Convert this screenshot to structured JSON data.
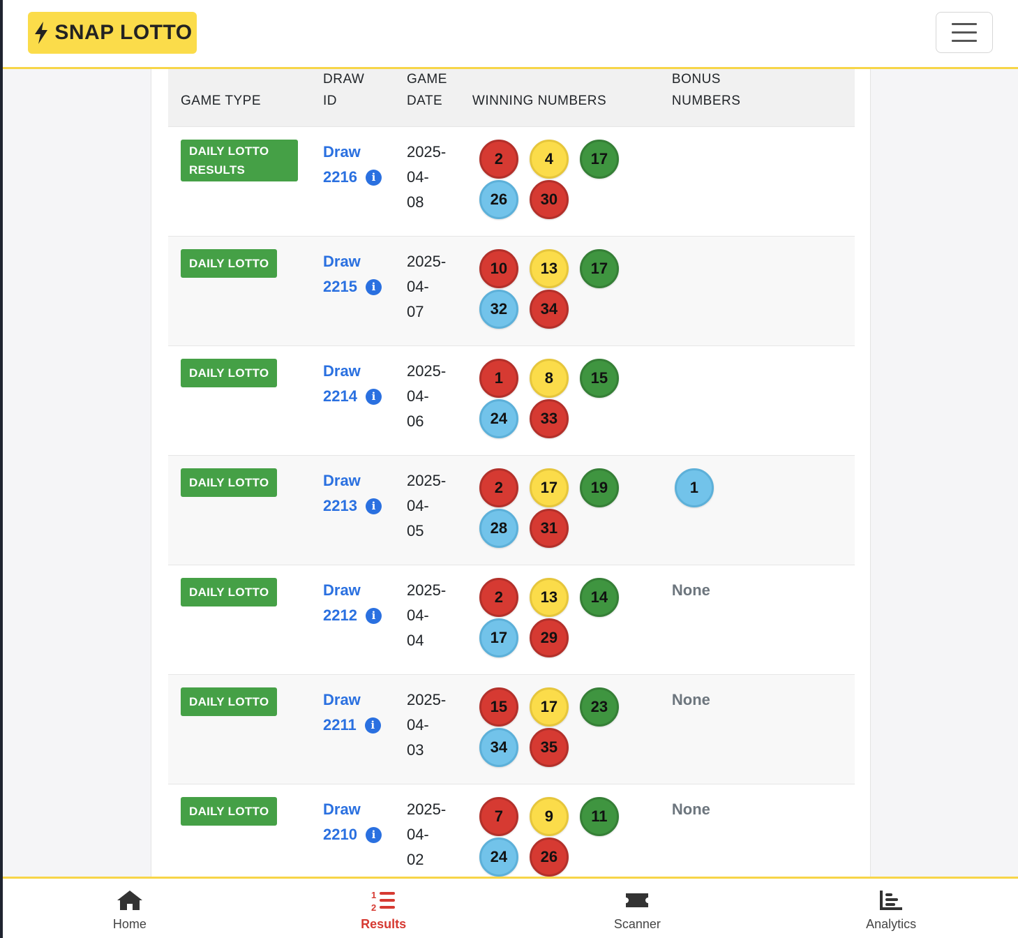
{
  "header": {
    "logo_text": "SNAP LOTTO",
    "logo_icon": "bolt-icon",
    "menu_icon": "hamburger-icon"
  },
  "table": {
    "columns": [
      "GAME TYPE",
      "DRAW ID",
      "GAME DATE",
      "WINNING NUMBERS",
      "BONUS NUMBERS"
    ],
    "rows": [
      {
        "game_type": "DAILY LOTTO RESULTS",
        "draw_word": "Draw",
        "draw_id": "2216",
        "date_a": "2025-04-",
        "date_b": "08",
        "numbers": [
          "2",
          "4",
          "17",
          "26",
          "30"
        ],
        "bonus": "",
        "bonus_balls": []
      },
      {
        "game_type": "DAILY LOTTO",
        "draw_word": "Draw",
        "draw_id": "2215",
        "date_a": "2025-04-",
        "date_b": "07",
        "numbers": [
          "10",
          "13",
          "17",
          "32",
          "34"
        ],
        "bonus": "",
        "bonus_balls": []
      },
      {
        "game_type": "DAILY LOTTO",
        "draw_word": "Draw",
        "draw_id": "2214",
        "date_a": "2025-04-",
        "date_b": "06",
        "numbers": [
          "1",
          "8",
          "15",
          "24",
          "33"
        ],
        "bonus": "",
        "bonus_balls": []
      },
      {
        "game_type": "DAILY LOTTO",
        "draw_word": "Draw",
        "draw_id": "2213",
        "date_a": "2025-04-",
        "date_b": "05",
        "numbers": [
          "2",
          "17",
          "19",
          "28",
          "31"
        ],
        "bonus": "",
        "bonus_balls": [
          "1"
        ]
      },
      {
        "game_type": "DAILY LOTTO",
        "draw_word": "Draw",
        "draw_id": "2212",
        "date_a": "2025-04-",
        "date_b": "04",
        "numbers": [
          "2",
          "13",
          "14",
          "17",
          "29"
        ],
        "bonus": "None",
        "bonus_balls": []
      },
      {
        "game_type": "DAILY LOTTO",
        "draw_word": "Draw",
        "draw_id": "2211",
        "date_a": "2025-04-",
        "date_b": "03",
        "numbers": [
          "15",
          "17",
          "23",
          "34",
          "35"
        ],
        "bonus": "None",
        "bonus_balls": []
      },
      {
        "game_type": "DAILY LOTTO",
        "draw_word": "Draw",
        "draw_id": "2210",
        "date_a": "2025-04-",
        "date_b": "02",
        "numbers": [
          "7",
          "9",
          "11",
          "24",
          "26"
        ],
        "bonus": "None",
        "bonus_balls": []
      }
    ],
    "ball_colors": [
      "red",
      "yellow",
      "green",
      "blue",
      "red"
    ],
    "bonus_ball_color": "blue"
  },
  "colors": {
    "accent": "#fbdc4a",
    "badge": "#45a046",
    "link": "#2a70e0",
    "active_nav": "#d63a32"
  },
  "bottom_nav": [
    {
      "label": "Home",
      "icon": "home-icon",
      "active": false
    },
    {
      "label": "Results",
      "icon": "list-ol-icon",
      "active": true
    },
    {
      "label": "Scanner",
      "icon": "ticket-icon",
      "active": false
    },
    {
      "label": "Analytics",
      "icon": "chart-bar-icon",
      "active": false
    }
  ]
}
